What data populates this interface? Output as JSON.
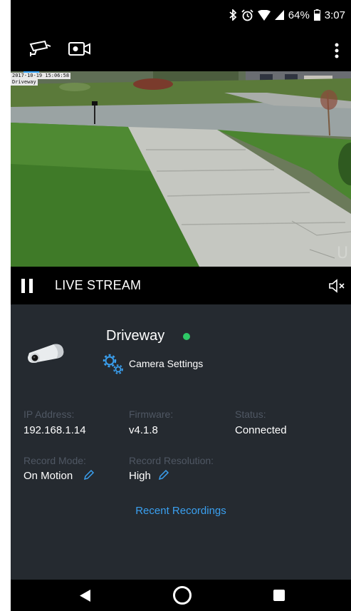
{
  "status_bar": {
    "battery": "64%",
    "time": "3:07"
  },
  "feed": {
    "timestamp": "2017-10-19 15:06:58",
    "camera_label": "Driveway"
  },
  "live": {
    "label": "LIVE STREAM"
  },
  "camera": {
    "name": "Driveway",
    "settings_label": "Camera Settings",
    "status_color": "#2ec866"
  },
  "details": {
    "ip_label": "IP Address:",
    "ip_value": "192.168.1.14",
    "firmware_label": "Firmware:",
    "firmware_value": "v4.1.8",
    "status_label": "Status:",
    "status_value": "Connected",
    "record_mode_label": "Record Mode:",
    "record_mode_value": "On Motion",
    "record_resolution_label": "Record Resolution:",
    "record_resolution_value": "High"
  },
  "links": {
    "recent_recordings": "Recent Recordings"
  },
  "colors": {
    "panel_bg": "#252a30",
    "accent": "#3aa0f0",
    "label_muted": "#4f5763"
  }
}
